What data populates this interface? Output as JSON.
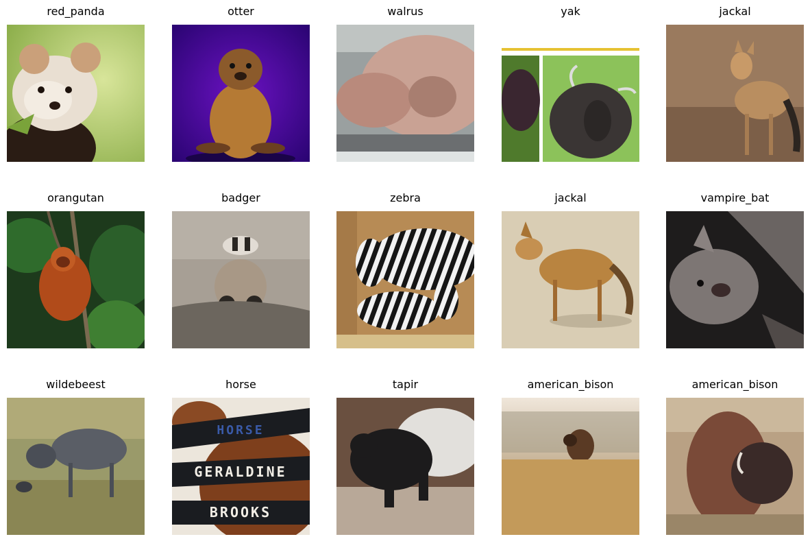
{
  "grid": {
    "rows": [
      [
        "red_panda",
        "otter",
        "walrus",
        "yak",
        "jackal"
      ],
      [
        "orangutan",
        "badger",
        "zebra",
        "jackal",
        "vampire_bat"
      ],
      [
        "wildebeest",
        "horse",
        "tapir",
        "american_bison",
        "american_bison"
      ]
    ]
  },
  "book_cover": {
    "line1": "HORSE",
    "line2": "GERALDINE",
    "line3": "BROOKS"
  }
}
